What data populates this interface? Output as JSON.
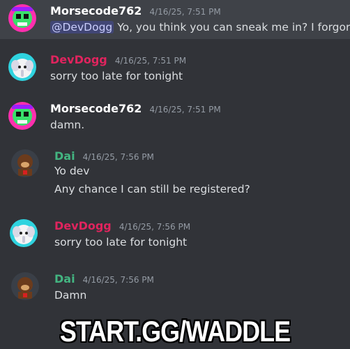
{
  "messages": [
    {
      "author": "Morsecode762",
      "author_color": "#ffffff",
      "avatar": "skull-avatar",
      "timestamp": "4/16/25, 7:51 PM",
      "mention": "@DevDogg",
      "lines": [
        "Yo, you think you can sneak me in? I forgor."
      ]
    },
    {
      "author": "DevDogg",
      "author_color": "#e0245e",
      "avatar": "elephant-avatar",
      "timestamp": "4/16/25, 7:51 PM",
      "lines": [
        "sorry too late for tonight"
      ]
    },
    {
      "author": "Morsecode762",
      "author_color": "#ffffff",
      "avatar": "skull-avatar",
      "timestamp": "4/16/25, 7:51 PM",
      "lines": [
        "damn."
      ]
    },
    {
      "author": "Dai",
      "author_color": "#43b581",
      "avatar": "donkey-kong-avatar",
      "timestamp": "4/16/25, 7:56 PM",
      "lines": [
        "Yo dev",
        "Any chance I can still be registered?"
      ]
    },
    {
      "author": "DevDogg",
      "author_color": "#e0245e",
      "avatar": "elephant-avatar",
      "timestamp": "4/16/25, 7:56 PM",
      "lines": [
        "sorry too late for tonight"
      ]
    },
    {
      "author": "Dai",
      "author_color": "#43b581",
      "avatar": "donkey-kong-avatar",
      "timestamp": "4/16/25, 7:56 PM",
      "lines": [
        "Damn"
      ]
    }
  ],
  "caption": "START.GG/WADDLE",
  "colors": {
    "background": "#313338",
    "highlight": "#3f4248",
    "mention_bg": "#414675",
    "timestamp": "#949ba4"
  }
}
